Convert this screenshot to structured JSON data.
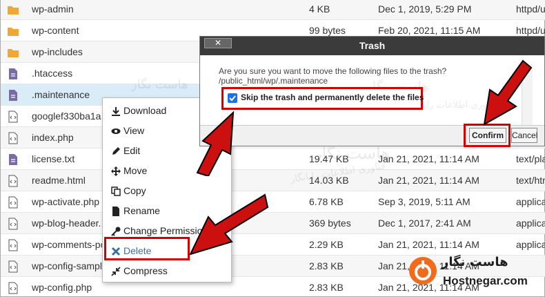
{
  "files": [
    {
      "name": "wp-admin",
      "icon": "folder-icon",
      "size": "4 KB",
      "date": "Dec 1, 2019, 5:29 PM",
      "type": "httpd/u"
    },
    {
      "name": "wp-content",
      "icon": "folder-icon",
      "size": "99 bytes",
      "date": "Feb 20, 2021, 11:15 AM",
      "type": "httpd/u"
    },
    {
      "name": "wp-includes",
      "icon": "folder-icon",
      "size": "",
      "date": "",
      "type": ""
    },
    {
      "name": ".htaccess",
      "icon": "text-file-icon",
      "size": "",
      "date": "",
      "type": ""
    },
    {
      "name": ".maintenance",
      "icon": "text-file-icon",
      "size": "",
      "date": "",
      "type": ""
    },
    {
      "name": "googlef330ba1a",
      "icon": "code-file-icon",
      "size": "",
      "date": "",
      "type": ""
    },
    {
      "name": "index.php",
      "icon": "code-file-icon",
      "size": "",
      "date": "",
      "type": ""
    },
    {
      "name": "license.txt",
      "icon": "text-file-icon",
      "size": "19.47 KB",
      "date": "Jan 21, 2021, 11:14 AM",
      "type": "text/pla"
    },
    {
      "name": "readme.html",
      "icon": "code-file-icon",
      "size": "14.03 KB",
      "date": "Jan 21, 2021, 11:14 AM",
      "type": "text/htm"
    },
    {
      "name": "wp-activate.php",
      "icon": "code-file-icon",
      "size": "6.78 KB",
      "date": "Sep 3, 2019, 5:11 AM",
      "type": "applica"
    },
    {
      "name": "wp-blog-header.",
      "icon": "code-file-icon",
      "size": "369 bytes",
      "date": "Dec 1, 2017, 2:41 AM",
      "type": "applica"
    },
    {
      "name": "wp-comments-po",
      "icon": "code-file-icon",
      "size": "2.29 KB",
      "date": "Jan 21, 2021, 11:14 AM",
      "type": "applica"
    },
    {
      "name": "wp-config-sampl",
      "icon": "code-file-icon",
      "size": "2.83 KB",
      "date": "Jan 21, 2021, 11:14 AM",
      "type": "applica"
    },
    {
      "name": "wp-config.php",
      "icon": "code-file-icon",
      "size": "2.83 KB",
      "date": "Jan 21, 2021, 11:14 AM",
      "type": "applica"
    }
  ],
  "context_menu": {
    "items": [
      {
        "label": "Download",
        "icon": "download-icon"
      },
      {
        "label": "View",
        "icon": "eye-icon"
      },
      {
        "label": "Edit",
        "icon": "pencil-icon"
      },
      {
        "label": "Move",
        "icon": "move-arrows-icon"
      },
      {
        "label": "Copy",
        "icon": "copy-icon"
      },
      {
        "label": "Rename",
        "icon": "file-icon"
      },
      {
        "label": "Change Permissions",
        "icon": "key-icon"
      },
      {
        "label": "Delete",
        "icon": "x-icon"
      },
      {
        "label": "Compress",
        "icon": "compress-icon"
      }
    ]
  },
  "dialog": {
    "title": "Trash",
    "close_label": "✕",
    "message": "Are you sure you want to move the following files to the trash?",
    "path": "/public_html/wp/.maintenance",
    "skip_checkbox_label": "Skip the trash and permanently delete the files",
    "skip_checked": true,
    "confirm_label": "Confirm",
    "cancel_label": "Cancel"
  },
  "watermark": {
    "brand_fa": "هاست نگار",
    "tagline_fa": "فناوری اطلاعات رایانگار"
  },
  "logo": {
    "name_fa": "هاست نگار",
    "name_en": "Hostnegar.com"
  },
  "colors": {
    "highlight_red": "#d40000",
    "arrow_red": "#cc1010",
    "folder": "#f0a833",
    "text_file": "#7a6aa8",
    "logo_orange": "#f26a1b"
  }
}
